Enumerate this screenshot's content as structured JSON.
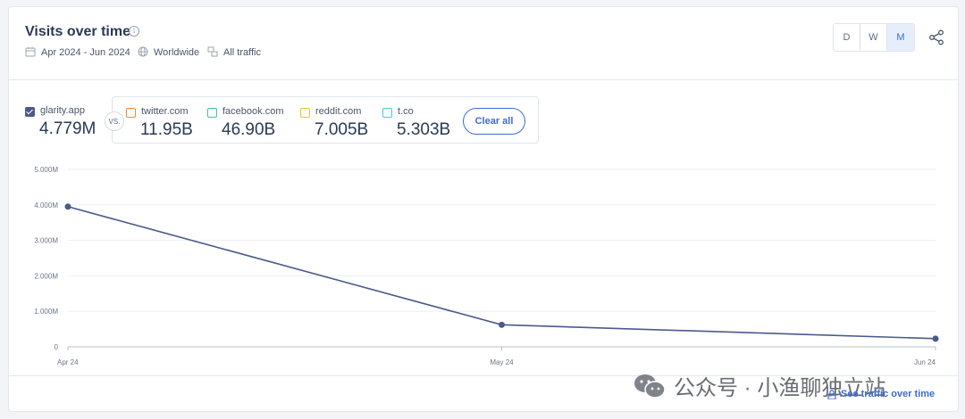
{
  "header": {
    "title": "Visits over time",
    "date_range": "Apr 2024 - Jun 2024",
    "region": "Worldwide",
    "traffic_type": "All traffic"
  },
  "granularity": {
    "options": [
      "D",
      "W",
      "M"
    ],
    "selected": "M"
  },
  "main_site": {
    "name": "glarity.app",
    "value": "4.779M",
    "color": "#4a5a8c"
  },
  "vs_label": "VS.",
  "competitors": [
    {
      "name": "twitter.com",
      "value": "11.95B",
      "color": "#f08a3c"
    },
    {
      "name": "facebook.com",
      "value": "46.90B",
      "color": "#3fbf9e"
    },
    {
      "name": "reddit.com",
      "value": "7.005B",
      "color": "#f0c030"
    },
    {
      "name": "t.co",
      "value": "5.303B",
      "color": "#4cc6d6"
    }
  ],
  "clear_all_label": "Clear all",
  "chart_data": {
    "type": "line",
    "categories": [
      "Apr 24",
      "May 24",
      "Jun 24"
    ],
    "series": [
      {
        "name": "glarity.app",
        "values": [
          3950000,
          620000,
          230000
        ],
        "color": "#4a5a8c"
      }
    ],
    "y_ticks": [
      "0",
      "1.000M",
      "2.000M",
      "3.000M",
      "4.000M",
      "5.000M"
    ],
    "ylim": [
      0,
      5000000
    ],
    "grid": true
  },
  "footer_link": "See traffic over time",
  "watermark": "公众号 · 小渔聊独立站"
}
